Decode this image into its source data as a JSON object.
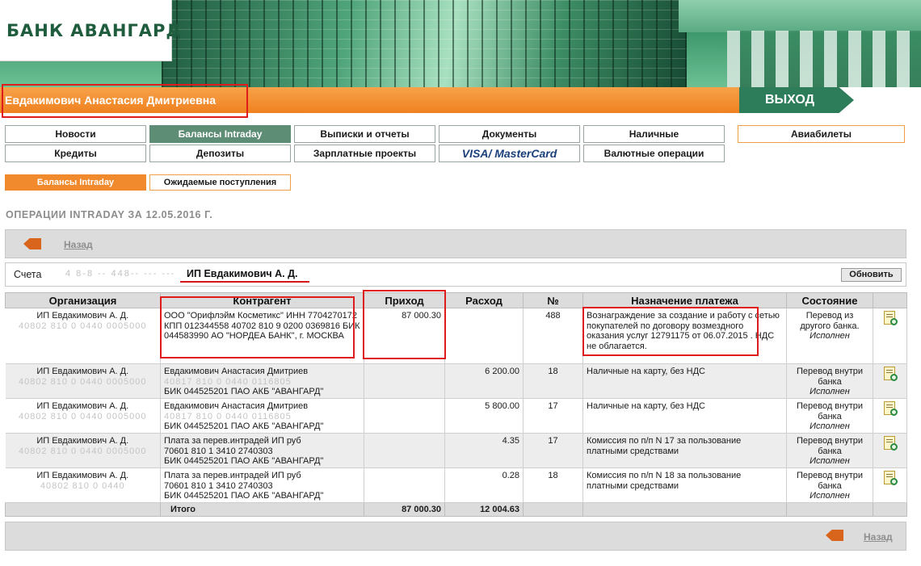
{
  "bank": {
    "logo_text": "БАНК АВАНГАРД"
  },
  "header": {
    "user_name": "Евдакимович Анастасия Дмитриевна",
    "exit_label": "ВЫХОД"
  },
  "nav": {
    "row1": [
      "Новости",
      "Балансы Intraday",
      "Выписки и отчеты",
      "Документы",
      "Наличные",
      "Авиабилеты"
    ],
    "row2": [
      "Кредиты",
      "Депозиты",
      "Зарплатные проекты",
      "VISA",
      "/ MasterCard",
      "Валютные операции"
    ],
    "active": "Балансы Intraday"
  },
  "subnav": {
    "items": [
      "Балансы Intraday",
      "Ожидаемые поступления"
    ]
  },
  "page": {
    "title": "ОПЕРАЦИИ INTRADAY ЗА 12.05.2016 Г.",
    "back_label": "Назад"
  },
  "accounts": {
    "label": "Счета",
    "account_masked": "4  8-8  -- 448-- ---  ---",
    "account_name": "ИП Евдакимович А. Д.",
    "refresh_label": "Обновить"
  },
  "table": {
    "headers": [
      "Организация",
      "Контрагент",
      "Приход",
      "Расход",
      "№",
      "Назначение платежа",
      "Состояние"
    ],
    "rows": [
      {
        "org": "ИП Евдакимович А. Д.",
        "org_masked": "40802 810 0 0440 0005000",
        "counterparty": "ООО \"Орифлэйм Косметикс\" ИНН 7704270172 КПП 012344558 40702 810 9 0200 0369816 БИК 044583990 АО \"НОРДЕА БАНК\", г. МОСКВА",
        "income": "87 000.30",
        "expense": "",
        "no": "488",
        "purpose": "Вознаграждение за создание и работу с сетью покупателей по договору возмездного оказания услуг 12791175 от 06.07.2015 . НДС не облагается.",
        "state": "Перевод из другого банка.",
        "status": "Исполнен"
      },
      {
        "org": "ИП Евдакимович А. Д.",
        "org_masked": "40802 810 0 0440 0005000",
        "counterparty_name": "Евдакимович Анастасия Дмитриев",
        "counterparty_masked": "40817 810 0 0440 0116805",
        "counterparty_bank": "БИК 044525201 ПАО АКБ \"АВАНГАРД\"",
        "income": "",
        "expense": "6 200.00",
        "no": "18",
        "purpose": "Наличные на карту, без НДС",
        "state": "Перевод внутри банка",
        "status": "Исполнен"
      },
      {
        "org": "ИП Евдакимович А. Д.",
        "org_masked": "40802 810 0 0440 0005000",
        "counterparty_name": "Евдакимович Анастасия Дмитриев",
        "counterparty_masked": "40817 810 0 0440 0116805",
        "counterparty_bank": "БИК 044525201 ПАО АКБ \"АВАНГАРД\"",
        "income": "",
        "expense": "5 800.00",
        "no": "17",
        "purpose": "Наличные на карту, без НДС",
        "state": "Перевод внутри банка",
        "status": "Исполнен"
      },
      {
        "org": "ИП Евдакимович А. Д.",
        "org_masked": "40802 810 0 0440 0005000",
        "counterparty_name": "Плата за перев.интрадей ИП руб",
        "counterparty_masked": "70601 810 1 3410 2740303",
        "counterparty_bank": "БИК 044525201 ПАО АКБ \"АВАНГАРД\"",
        "income": "",
        "expense": "4.35",
        "no": "17",
        "purpose": "Комиссия по п/п N 17 за пользование платными средствами",
        "state": "Перевод внутри банка",
        "status": "Исполнен"
      },
      {
        "org": "ИП Евдакимович А. Д.",
        "org_masked": "40802 810 0 0440",
        "counterparty_name": "Плата за перев.интрадей ИП руб",
        "counterparty_masked": "70601 810 1 3410 2740303",
        "counterparty_bank": "БИК 044525201 ПАО АКБ \"АВАНГАРД\"",
        "income": "",
        "expense": "0.28",
        "no": "18",
        "purpose": "Комиссия по п/п N 18 за пользование платными средствами",
        "state": "Перевод внутри банка",
        "status": "Исполнен"
      }
    ],
    "total": {
      "label": "Итого",
      "income": "87 000.30",
      "expense": "12 004.63"
    }
  },
  "colors": {
    "accent_orange": "#f08a2c",
    "brand_green": "#2e7d5a",
    "highlight_red": "#e01b1b"
  }
}
